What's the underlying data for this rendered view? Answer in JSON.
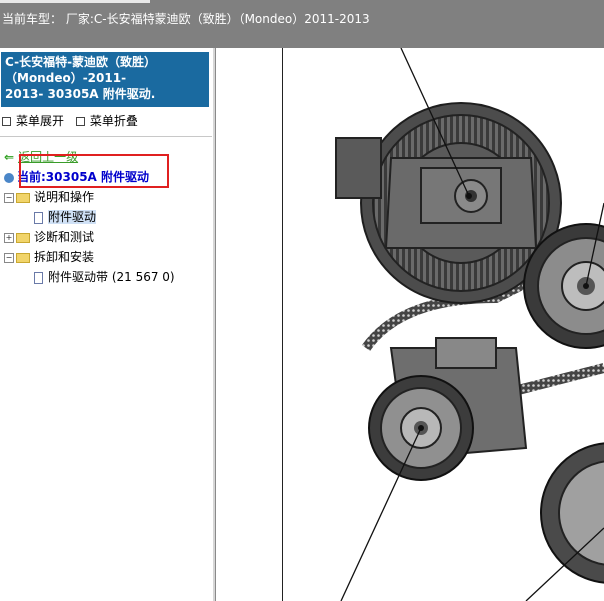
{
  "topbar": {
    "title": "当前车型：  厂家:C-长安福特蒙迪欧（致胜）（Mondeo）2011-2013"
  },
  "left": {
    "header": {
      "line1": "C-长安福特-蒙迪欧（致胜）",
      "line2": "（Mondeo）-2011-",
      "line3": "2013- 30305A 附件驱动."
    },
    "menu": {
      "expand": "菜单展开",
      "collapse": "菜单折叠"
    },
    "back": "返回上一级",
    "current": "当前:30305A 附件驱动",
    "tree": [
      {
        "label": "说明和操作",
        "expanded": true,
        "children": [
          "附件驱动"
        ]
      },
      {
        "label": "诊断和测试",
        "expanded": false,
        "children": []
      },
      {
        "label": "拆卸和安装",
        "expanded": true,
        "children": [
          "附件驱动带 (21 567 0)"
        ]
      }
    ]
  },
  "colors": {
    "header_bg": "#1a6aa0",
    "topbar_bg": "#808080",
    "highlight": "#e02020",
    "current_text": "#0000cc"
  }
}
